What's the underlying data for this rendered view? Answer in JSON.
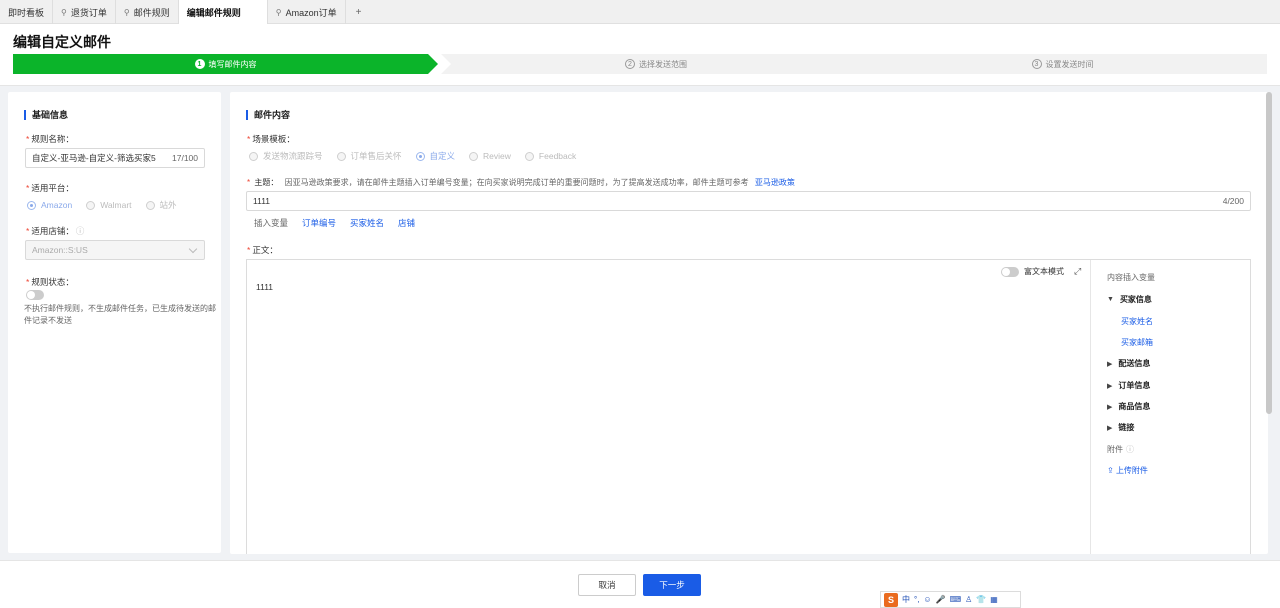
{
  "tabs": [
    {
      "label": "即时看板",
      "pinned": false,
      "active": false
    },
    {
      "label": "退货订单",
      "pinned": true,
      "active": false
    },
    {
      "label": "邮件规则",
      "pinned": true,
      "active": false
    },
    {
      "label": "编辑邮件规则",
      "pinned": false,
      "active": true
    },
    {
      "label": "Amazon订单",
      "pinned": true,
      "active": false
    }
  ],
  "tab_add_label": "+",
  "page_title": "编辑自定义邮件",
  "steps": [
    {
      "num": "1",
      "label": "填写邮件内容",
      "active": true
    },
    {
      "num": "2",
      "label": "选择发送范围",
      "active": false
    },
    {
      "num": "3",
      "label": "设置发送时间",
      "active": false
    }
  ],
  "basic": {
    "section_title": "基础信息",
    "rule_name_label": "规则名称：",
    "rule_name_value": "自定义-亚马逊-自定义-筛选买家5",
    "rule_name_counter": "17/100",
    "platform_label": "适用平台：",
    "platform_options": [
      "Amazon",
      "Walmart",
      "站外"
    ],
    "platform_selected": "Amazon",
    "store_label": "适用店铺：",
    "store_value": "Amazon::S:US",
    "status_label": "规则状态：",
    "status_hint": "不执行邮件规则，不生成邮件任务，已生成待发送的邮件记录不发送"
  },
  "content": {
    "section_title": "邮件内容",
    "template_label": "场景模板：",
    "template_options": [
      "发送物流跟踪号",
      "订单售后关怀",
      "自定义",
      "Review",
      "Feedback"
    ],
    "template_selected": "自定义",
    "subject_label": "主题：",
    "subject_notice": "因亚马逊政策要求，请在邮件主题插入订单编号变量；在向买家说明完成订单的重要问题时，为了提高发送成功率，邮件主题可参考",
    "subject_policy_link": "亚马逊政策",
    "subject_value": "1111",
    "subject_counter": "4/200",
    "insert_var_label": "插入变量",
    "insert_vars": [
      "订单编号",
      "买家姓名",
      "店铺"
    ],
    "body_label": "正文：",
    "rich_text_label": "富文本模式",
    "body_value": "1111",
    "side_title": "内容插入变量",
    "var_groups": [
      {
        "label": "买家信息",
        "expanded": true,
        "items": [
          "买家姓名",
          "买家邮箱"
        ]
      },
      {
        "label": "配送信息",
        "expanded": false,
        "items": []
      },
      {
        "label": "订单信息",
        "expanded": false,
        "items": []
      },
      {
        "label": "商品信息",
        "expanded": false,
        "items": []
      },
      {
        "label": "链接",
        "expanded": false,
        "items": []
      }
    ],
    "attachment_label": "附件",
    "upload_label": "上传附件"
  },
  "footer": {
    "cancel_label": "取消",
    "next_label": "下一步"
  },
  "ime": {
    "logo": "S",
    "lang": "中"
  },
  "colors": {
    "primary": "#1a5ce6",
    "step_active": "#0bb42a",
    "required": "#e43"
  }
}
